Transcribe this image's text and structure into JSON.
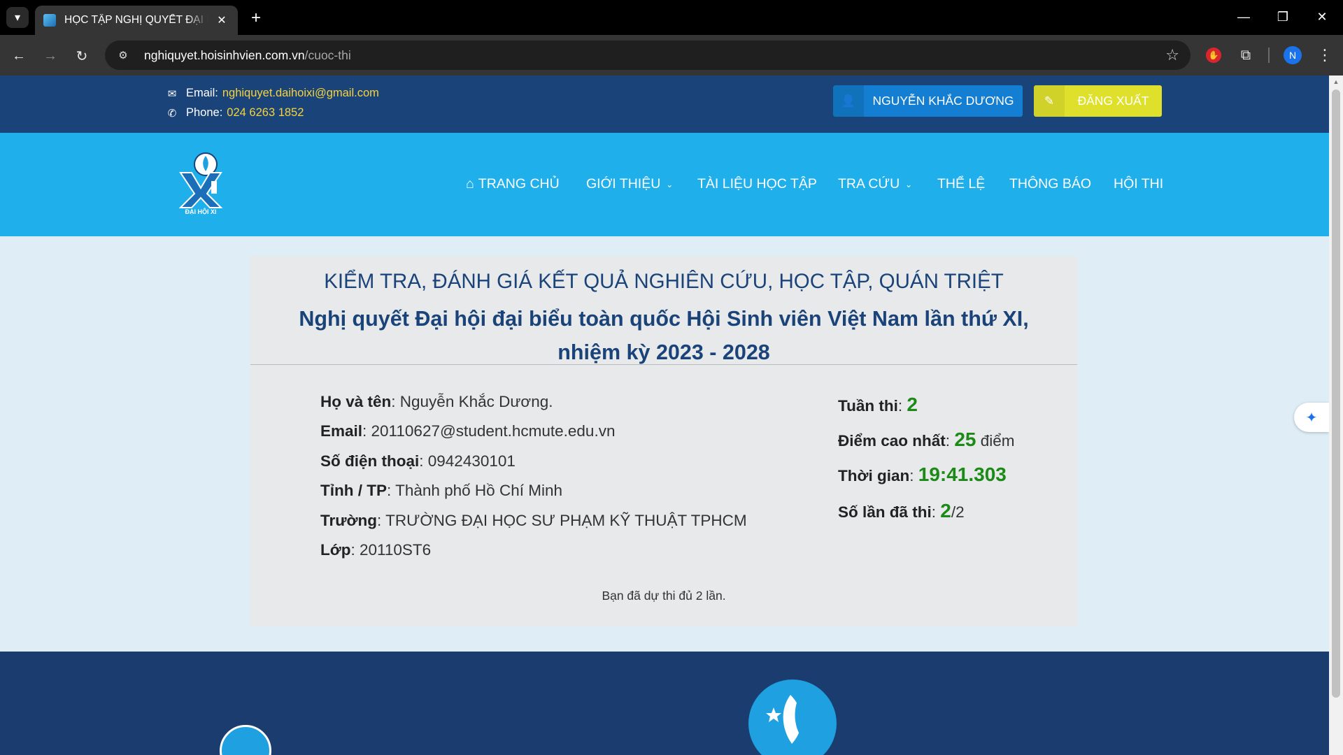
{
  "browser": {
    "tab_title": "HỌC TẬP NGHỊ QUYẾT ĐẠI HỘI XI",
    "url_domain": "nghiquyet.hoisinhvien.com.vn",
    "url_path": "/cuoc-thi",
    "profile_initial": "N"
  },
  "topbar": {
    "email_label": "Email:",
    "email_value": "nghiquyet.daihoixi@gmail.com",
    "phone_label": "Phone:",
    "phone_value": "024 6263 1852",
    "user_button": "NGUYỄN KHẮC DƯƠNG",
    "logout_button": "ĐĂNG XUẤT"
  },
  "nav": {
    "logo_text": "ĐẠI HỘI XI",
    "items": [
      {
        "label": "TRANG CHỦ"
      },
      {
        "label": "GIỚI THIỆU"
      },
      {
        "label": "TÀI LIỆU HỌC TẬP"
      },
      {
        "label": "TRA CỨU"
      },
      {
        "label": "THỂ LỆ"
      },
      {
        "label": "THÔNG BÁO"
      },
      {
        "label": "HỘI THI"
      }
    ]
  },
  "card": {
    "heading": "KIỂM TRA, ĐÁNH GIÁ KẾT QUẢ NGHIÊN CỨU, HỌC TẬP, QUÁN TRIỆT",
    "subheading_line1": "Nghị quyết Đại hội đại biểu toàn quốc Hội Sinh viên Việt Nam lần thứ XI,",
    "subheading_line2": "nhiệm kỳ 2023 - 2028",
    "info": [
      {
        "label": "Họ và tên",
        "value": ": Nguyễn Khắc Dương."
      },
      {
        "label": "Email",
        "value": ": 20110627@student.hcmute.edu.vn"
      },
      {
        "label": "Số điện thoại",
        "value": ": 0942430101"
      },
      {
        "label": "Tỉnh / TP",
        "value": ": Thành phố Hồ Chí Minh"
      },
      {
        "label": "Trường",
        "value": ": TRƯỜNG ĐẠI HỌC SƯ PHẠM KỸ THUẬT TPHCM"
      },
      {
        "label": "Lớp",
        "value": ": 20110ST6"
      }
    ],
    "stats": {
      "week_label": "Tuần thi",
      "week_value": "2",
      "score_label": "Điểm cao nhất",
      "score_value": "25",
      "score_unit": "điểm",
      "time_label": "Thời gian",
      "time_value": "19:41.303",
      "attempts_label": "Số lần đã thi",
      "attempts_value": "2",
      "attempts_total": "/2"
    },
    "note": "Bạn đã dự thi đủ 2 lần."
  },
  "colors": {
    "topbar_bg": "#1a4479",
    "navbar_bg": "#1fb0ec",
    "accent_yellow": "#dfe02c",
    "highlight_green": "#1c8a16"
  }
}
